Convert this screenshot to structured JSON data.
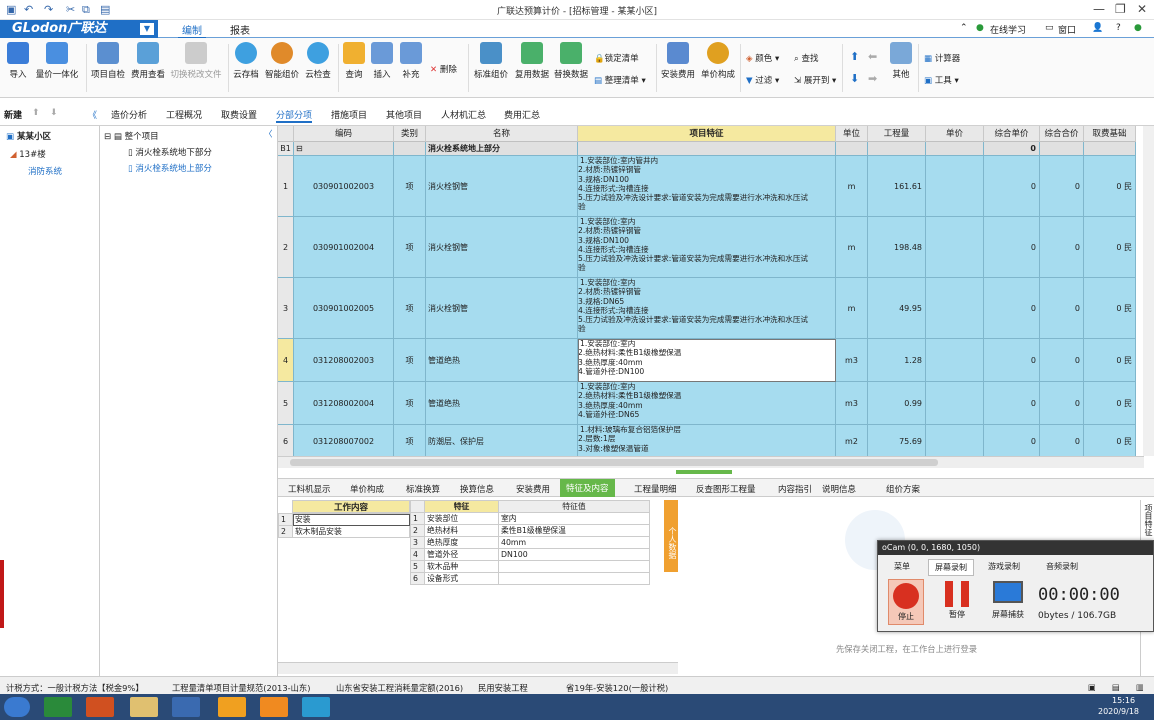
{
  "window": {
    "title": "广联达预算计价 - [招标管理 - 某某小区]"
  },
  "menu": {
    "logo": "GLodon广联达",
    "tabs": [
      "编制",
      "报表"
    ],
    "right": [
      "在线学习",
      "窗口"
    ]
  },
  "ribbon": {
    "buttons": [
      "导入",
      "量价一体化",
      "项目自检",
      "费用查看",
      "切换税改文件",
      "云存档",
      "智能组价",
      "云检查",
      "查询",
      "插入",
      "补充",
      "标准组价",
      "复用数据",
      "替换数据",
      "安装费用",
      "单价构成",
      "其他"
    ],
    "small": [
      "删除",
      "锁定清单",
      "整理清单",
      "颜色",
      "查找",
      "过滤",
      "展开到",
      "计算器",
      "工具"
    ]
  },
  "sidebar_top": {
    "new": "新建"
  },
  "nav_tabs": [
    "造价分析",
    "工程概况",
    "取费设置",
    "分部分项",
    "措施项目",
    "其他项目",
    "人材机汇总",
    "费用汇总"
  ],
  "left_tree": {
    "project": "某某小区",
    "building": "13#楼",
    "system": "消防系统"
  },
  "section_tree": {
    "root": "整个项目",
    "items": [
      "消火栓系统地下部分",
      "消火栓系统地上部分"
    ]
  },
  "grid": {
    "headers": [
      "编码",
      "类别",
      "名称",
      "项目特征",
      "单位",
      "工程量",
      "单价",
      "综合单价",
      "综合合价",
      "取费基础"
    ],
    "section": {
      "label": "B1",
      "name": "消火栓系统地上部分",
      "total": "0"
    },
    "rows": [
      {
        "no": "1",
        "code": "030901002003",
        "type": "项",
        "name": "消火栓钢管",
        "feature": "1.安装部位:室内管井内\n2.材质:热镀锌钢管\n3.规格:DN100\n4.连接形式:沟槽连接\n5.压力试验及冲洗设计要求:管道安装为完成需要进行水冲洗和水压试\n验",
        "unit": "m",
        "qty": "161.61",
        "price": "",
        "unit_total": "0",
        "sum": "0",
        "base": "0 民"
      },
      {
        "no": "2",
        "code": "030901002004",
        "type": "项",
        "name": "消火栓钢管",
        "feature": "1.安装部位:室内\n2.材质:热镀锌钢管\n3.规格:DN100\n4.连接形式:沟槽连接\n5.压力试验及冲洗设计要求:管道安装为完成需要进行水冲洗和水压试\n验",
        "unit": "m",
        "qty": "198.48",
        "price": "",
        "unit_total": "0",
        "sum": "0",
        "base": "0 民"
      },
      {
        "no": "3",
        "code": "030901002005",
        "type": "项",
        "name": "消火栓钢管",
        "feature": "1.安装部位:室内\n2.材质:热镀锌钢管\n3.规格:DN65\n4.连接形式:沟槽连接\n5.压力试验及冲洗设计要求:管道安装为完成需要进行水冲洗和水压试\n验",
        "unit": "m",
        "qty": "49.95",
        "price": "",
        "unit_total": "0",
        "sum": "0",
        "base": "0 民"
      },
      {
        "no": "4",
        "code": "031208002003",
        "type": "项",
        "name": "管道绝热",
        "feature": "1.安装部位:室内\n2.绝热材料:柔性B1级橡塑保温\n3.绝热厚度:40mm\n4.管道外径:DN100",
        "unit": "m3",
        "qty": "1.28",
        "price": "",
        "unit_total": "0",
        "sum": "0",
        "base": "0 民"
      },
      {
        "no": "5",
        "code": "031208002004",
        "type": "项",
        "name": "管道绝热",
        "feature": "1.安装部位:室内\n2.绝热材料:柔性B1级橡塑保温\n3.绝热厚度:40mm\n4.管道外径:DN65",
        "unit": "m3",
        "qty": "0.99",
        "price": "",
        "unit_total": "0",
        "sum": "0",
        "base": "0 民"
      },
      {
        "no": "6",
        "code": "031208007002",
        "type": "项",
        "name": "防潮层、保护层",
        "feature": "1.材料:玻璃布复合铝箔保护层\n2.层数:1层\n3.对象:橡塑保温管道",
        "unit": "m2",
        "qty": "75.69",
        "price": "",
        "unit_total": "0",
        "sum": "0",
        "base": "0 民"
      }
    ]
  },
  "bottom_tabs": [
    "工料机显示",
    "单价构成",
    "标准换算",
    "换算信息",
    "安装费用",
    "特征及内容",
    "工程量明细",
    "反查图形工程量",
    "内容指引",
    "说明信息",
    "组价方案"
  ],
  "work_content": {
    "header": "工作内容",
    "rows": [
      {
        "no": "1",
        "text": "安装"
      },
      {
        "no": "2",
        "text": "软木制品安装"
      }
    ]
  },
  "features": {
    "h1": "特征",
    "h2": "特征值",
    "rows": [
      {
        "no": "1",
        "name": "安装部位",
        "value": "室内"
      },
      {
        "no": "2",
        "name": "绝热材料",
        "value": "柔性B1级橡塑保温"
      },
      {
        "no": "3",
        "name": "绝热厚度",
        "value": "40mm"
      },
      {
        "no": "4",
        "name": "管道外径",
        "value": "DN100"
      },
      {
        "no": "5",
        "name": "软木品种",
        "value": ""
      },
      {
        "no": "6",
        "name": "设备形式",
        "value": ""
      }
    ]
  },
  "side_label": "个人数据",
  "hint": "先保存关闭工程，在工作台上进行登录",
  "right_vertical": "项目特征",
  "ocam": {
    "title": "oCam (0, 0, 1680, 1050)",
    "tabs": [
      "菜单",
      "屏幕录制",
      "游戏录制",
      "音频录制"
    ],
    "stop": "停止",
    "pause": "暂停",
    "capture": "屏幕捕获",
    "time": "00:00:00",
    "size": "0bytes / 106.7GB"
  },
  "status": [
    "计税方式：一般计税方法【税金9%】",
    "工程量清单项目计量规范(2013-山东)",
    "山东省安装工程消耗量定额(2016)",
    "民用安装工程",
    "省19年-安装120(一般计税)"
  ],
  "taskbar": {
    "time": "15:16",
    "date": "2020/9/18"
  }
}
